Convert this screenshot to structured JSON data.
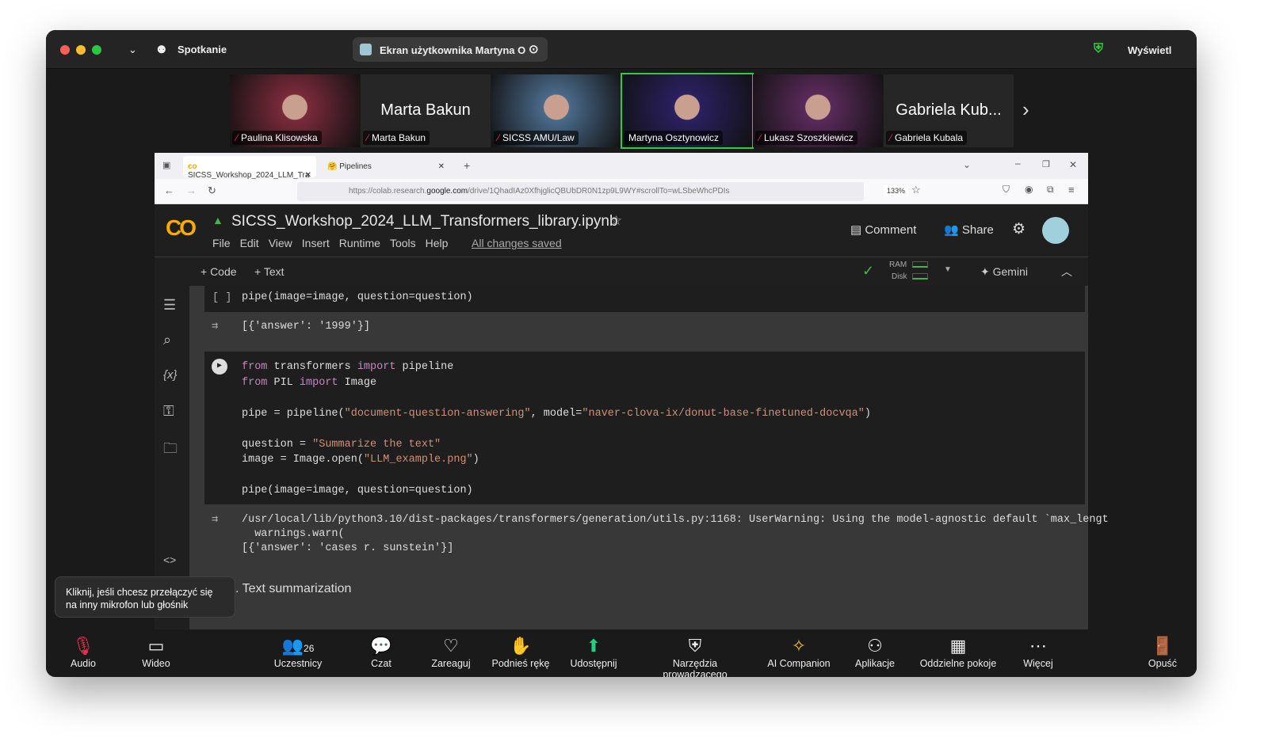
{
  "meeting": {
    "title": "Spotkanie",
    "share_label": "Ekran użytkownika Martyna O",
    "view_label": "Wyświetl"
  },
  "participants": [
    {
      "name": "Paulina Klisowska",
      "video": true,
      "color": "#7a2a3a"
    },
    {
      "name": "Marta Bakun",
      "video": false,
      "big": "Marta Bakun"
    },
    {
      "name": "SICSS AMU/Law",
      "video": true,
      "color": "#4a6a8a"
    },
    {
      "name": "Martyna Osztynowicz",
      "video": true,
      "color": "#2a2060",
      "active": true
    },
    {
      "name": "Lukasz Szoszkiewicz",
      "video": true,
      "color": "#5a2a5a"
    },
    {
      "name": "Gabriela Kubala",
      "video": false,
      "big": "Gabriela Kub..."
    }
  ],
  "browser": {
    "tabs": [
      {
        "label": "SICSS_Workshop_2024_LLM_Tra"
      },
      {
        "label": "Pipelines"
      }
    ],
    "url_prefix": "https://colab.research.",
    "url_domain": "google.com",
    "url_rest": "/drive/1QhadIAz0XfhjglicQBUbDR0N1zp9L9WY#scrollTo=wLSbeWhcPDIs",
    "zoom": "133%"
  },
  "colab": {
    "logo": "CO",
    "filename": "SICSS_Workshop_2024_LLM_Transformers_library.ipynb",
    "menu": [
      "File",
      "Edit",
      "View",
      "Insert",
      "Runtime",
      "Tools",
      "Help"
    ],
    "saved": "All changes saved",
    "comment": "Comment",
    "share": "Share",
    "add_code": "+ Code",
    "add_text": "+ Text",
    "ram": "RAM",
    "disk": "Disk",
    "gemini": "✦ Gemini"
  },
  "cells": {
    "c1_code": "pipe(image=image, question=question)",
    "c1_out": "[{'answer': '1999'}]",
    "c2_out1": "/usr/local/lib/python3.10/dist-packages/transformers/generation/utils.py:1168: UserWarning: Using the model-agnostic default `max_lengt",
    "c2_out2": "  warnings.warn(",
    "c2_out3": "[{'answer': 'cases r. sunstein'}]",
    "section": ". Text summarization"
  },
  "tooltip": "Kliknij, jeśli chcesz przełączyć się na inny mikrofon lub głośnik",
  "toolbar": [
    {
      "label": "Audio",
      "icon": "🎙"
    },
    {
      "label": "Wideo",
      "icon": "▭"
    },
    {
      "label": "Uczestnicy",
      "icon": "👥",
      "count": "26"
    },
    {
      "label": "Czat",
      "icon": "💬"
    },
    {
      "label": "Zareaguj",
      "icon": "♡"
    },
    {
      "label": "Podnieś rękę",
      "icon": "✋"
    },
    {
      "label": "Udostępnij",
      "icon": "⬆"
    },
    {
      "label": "Narzędzia prowadzącego",
      "icon": "⛨"
    },
    {
      "label": "AI Companion",
      "icon": "✧"
    },
    {
      "label": "Aplikacje",
      "icon": "⚇"
    },
    {
      "label": "Oddzielne pokoje",
      "icon": "▦"
    },
    {
      "label": "Więcej",
      "icon": "⋯"
    },
    {
      "label": "Opuść",
      "icon": "🚪"
    }
  ]
}
